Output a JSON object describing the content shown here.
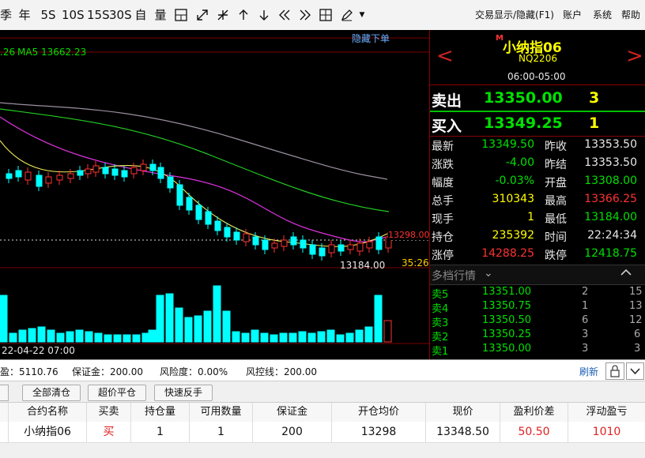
{
  "toolbar": {
    "periods": [
      "季",
      "年",
      "5S",
      "10S",
      "15S",
      "30S"
    ],
    "tools": [
      "自",
      "量"
    ],
    "right_menu": [
      "交易显示/隐藏(F1)",
      "账户",
      "系统",
      "帮助"
    ]
  },
  "chart": {
    "ma_label_partial": ".26",
    "ma5_label": "MA5 13662.23",
    "hide_orders": "隐藏下单",
    "price_marker": "13298.00",
    "low_marker": "13184.00",
    "time_marker": "35:26",
    "date_label": "22-04-22 07:00"
  },
  "quote": {
    "name": "小纳指06",
    "flag": "M",
    "code": "NQ2206",
    "session": "06:00-05:00",
    "ask_label": "卖出",
    "ask_price": "13350.00",
    "ask_vol": "3",
    "bid_label": "买入",
    "bid_price": "13349.25",
    "bid_vol": "1",
    "rows": [
      {
        "l1": "最新",
        "v1": "13349.50",
        "l2": "昨收",
        "v2": "13353.50"
      },
      {
        "l1": "涨跌",
        "v1": "-4.00",
        "l2": "昨结",
        "v2": "13353.50"
      },
      {
        "l1": "幅度",
        "v1": "-0.03%",
        "l2": "开盘",
        "v2": "13308.00"
      },
      {
        "l1": "总手",
        "v1": "310343",
        "l2": "最高",
        "v2": "13366.25"
      },
      {
        "l1": "现手",
        "v1": "1",
        "l2": "最低",
        "v2": "13184.00"
      },
      {
        "l1": "持仓",
        "v1": "235392",
        "l2": "时间",
        "v2": "22:24:34"
      },
      {
        "l1": "涨停",
        "v1": "14288.25",
        "l2": "跌停",
        "v2": "12418.75"
      }
    ],
    "depth_title": "多档行情",
    "depth": [
      {
        "label": "卖5",
        "price": "13351.00",
        "vol": "2",
        "extra": "15"
      },
      {
        "label": "卖4",
        "price": "13350.75",
        "vol": "1",
        "extra": "13"
      },
      {
        "label": "卖3",
        "price": "13350.50",
        "vol": "6",
        "extra": "12"
      },
      {
        "label": "卖2",
        "price": "13350.25",
        "vol": "3",
        "extra": "6"
      },
      {
        "label": "卖1",
        "price": "13350.00",
        "vol": "3",
        "extra": "3"
      }
    ]
  },
  "account": {
    "pnl": "盈：5110.76",
    "margin": "保证金：200.00",
    "risk": "风险度：0.00%",
    "stop": "风控线：200.00",
    "refresh": "刷新"
  },
  "actions": {
    "close_all": "全部清仓",
    "over_close": "超价平仓",
    "fast_reverse": "快速反手"
  },
  "positions": {
    "headers": [
      "合约名称",
      "买卖",
      "持仓量",
      "可用数量",
      "保证金",
      "开仓均价",
      "现价",
      "盈利价差",
      "浮动盈亏"
    ],
    "rows": [
      [
        "小纳指06",
        "买",
        "1",
        "1",
        "200",
        "13298",
        "13348.50",
        "50.50",
        "1010"
      ]
    ]
  },
  "colors": {
    "up": "#ff3232",
    "down": "#00ffff",
    "bg": "#000000",
    "accent": "#00e000"
  }
}
